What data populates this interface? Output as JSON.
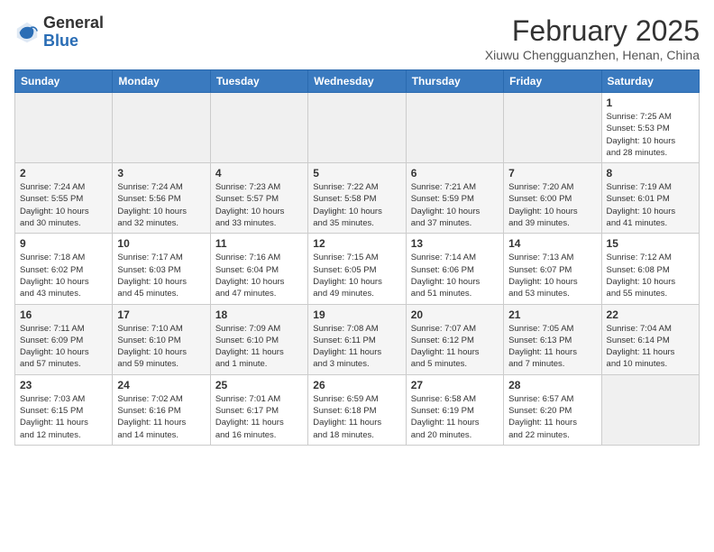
{
  "header": {
    "logo_general": "General",
    "logo_blue": "Blue",
    "month_title": "February 2025",
    "subtitle": "Xiuwu Chengguanzhen, Henan, China"
  },
  "weekdays": [
    "Sunday",
    "Monday",
    "Tuesday",
    "Wednesday",
    "Thursday",
    "Friday",
    "Saturday"
  ],
  "weeks": [
    [
      {
        "day": "",
        "info": ""
      },
      {
        "day": "",
        "info": ""
      },
      {
        "day": "",
        "info": ""
      },
      {
        "day": "",
        "info": ""
      },
      {
        "day": "",
        "info": ""
      },
      {
        "day": "",
        "info": ""
      },
      {
        "day": "1",
        "info": "Sunrise: 7:25 AM\nSunset: 5:53 PM\nDaylight: 10 hours\nand 28 minutes."
      }
    ],
    [
      {
        "day": "2",
        "info": "Sunrise: 7:24 AM\nSunset: 5:55 PM\nDaylight: 10 hours\nand 30 minutes."
      },
      {
        "day": "3",
        "info": "Sunrise: 7:24 AM\nSunset: 5:56 PM\nDaylight: 10 hours\nand 32 minutes."
      },
      {
        "day": "4",
        "info": "Sunrise: 7:23 AM\nSunset: 5:57 PM\nDaylight: 10 hours\nand 33 minutes."
      },
      {
        "day": "5",
        "info": "Sunrise: 7:22 AM\nSunset: 5:58 PM\nDaylight: 10 hours\nand 35 minutes."
      },
      {
        "day": "6",
        "info": "Sunrise: 7:21 AM\nSunset: 5:59 PM\nDaylight: 10 hours\nand 37 minutes."
      },
      {
        "day": "7",
        "info": "Sunrise: 7:20 AM\nSunset: 6:00 PM\nDaylight: 10 hours\nand 39 minutes."
      },
      {
        "day": "8",
        "info": "Sunrise: 7:19 AM\nSunset: 6:01 PM\nDaylight: 10 hours\nand 41 minutes."
      }
    ],
    [
      {
        "day": "9",
        "info": "Sunrise: 7:18 AM\nSunset: 6:02 PM\nDaylight: 10 hours\nand 43 minutes."
      },
      {
        "day": "10",
        "info": "Sunrise: 7:17 AM\nSunset: 6:03 PM\nDaylight: 10 hours\nand 45 minutes."
      },
      {
        "day": "11",
        "info": "Sunrise: 7:16 AM\nSunset: 6:04 PM\nDaylight: 10 hours\nand 47 minutes."
      },
      {
        "day": "12",
        "info": "Sunrise: 7:15 AM\nSunset: 6:05 PM\nDaylight: 10 hours\nand 49 minutes."
      },
      {
        "day": "13",
        "info": "Sunrise: 7:14 AM\nSunset: 6:06 PM\nDaylight: 10 hours\nand 51 minutes."
      },
      {
        "day": "14",
        "info": "Sunrise: 7:13 AM\nSunset: 6:07 PM\nDaylight: 10 hours\nand 53 minutes."
      },
      {
        "day": "15",
        "info": "Sunrise: 7:12 AM\nSunset: 6:08 PM\nDaylight: 10 hours\nand 55 minutes."
      }
    ],
    [
      {
        "day": "16",
        "info": "Sunrise: 7:11 AM\nSunset: 6:09 PM\nDaylight: 10 hours\nand 57 minutes."
      },
      {
        "day": "17",
        "info": "Sunrise: 7:10 AM\nSunset: 6:10 PM\nDaylight: 10 hours\nand 59 minutes."
      },
      {
        "day": "18",
        "info": "Sunrise: 7:09 AM\nSunset: 6:10 PM\nDaylight: 11 hours\nand 1 minute."
      },
      {
        "day": "19",
        "info": "Sunrise: 7:08 AM\nSunset: 6:11 PM\nDaylight: 11 hours\nand 3 minutes."
      },
      {
        "day": "20",
        "info": "Sunrise: 7:07 AM\nSunset: 6:12 PM\nDaylight: 11 hours\nand 5 minutes."
      },
      {
        "day": "21",
        "info": "Sunrise: 7:05 AM\nSunset: 6:13 PM\nDaylight: 11 hours\nand 7 minutes."
      },
      {
        "day": "22",
        "info": "Sunrise: 7:04 AM\nSunset: 6:14 PM\nDaylight: 11 hours\nand 10 minutes."
      }
    ],
    [
      {
        "day": "23",
        "info": "Sunrise: 7:03 AM\nSunset: 6:15 PM\nDaylight: 11 hours\nand 12 minutes."
      },
      {
        "day": "24",
        "info": "Sunrise: 7:02 AM\nSunset: 6:16 PM\nDaylight: 11 hours\nand 14 minutes."
      },
      {
        "day": "25",
        "info": "Sunrise: 7:01 AM\nSunset: 6:17 PM\nDaylight: 11 hours\nand 16 minutes."
      },
      {
        "day": "26",
        "info": "Sunrise: 6:59 AM\nSunset: 6:18 PM\nDaylight: 11 hours\nand 18 minutes."
      },
      {
        "day": "27",
        "info": "Sunrise: 6:58 AM\nSunset: 6:19 PM\nDaylight: 11 hours\nand 20 minutes."
      },
      {
        "day": "28",
        "info": "Sunrise: 6:57 AM\nSunset: 6:20 PM\nDaylight: 11 hours\nand 22 minutes."
      },
      {
        "day": "",
        "info": ""
      }
    ]
  ]
}
